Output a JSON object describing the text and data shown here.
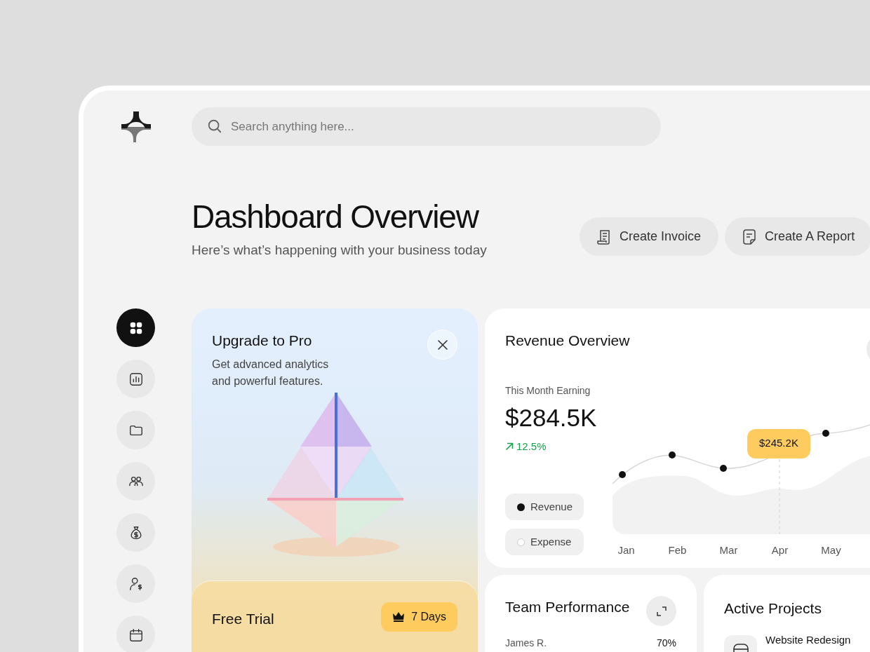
{
  "search": {
    "placeholder": "Search anything here..."
  },
  "header": {
    "title": "Dashboard Overview",
    "subtitle": "Here’s what’s happening with your business today"
  },
  "actions": [
    {
      "kind": "invoice",
      "label": "Create Invoice"
    },
    {
      "kind": "report",
      "label": "Create A Report"
    }
  ],
  "sidebar": {
    "items": [
      {
        "kind": "dashboard",
        "selected": true
      },
      {
        "kind": "analytics",
        "selected": false
      },
      {
        "kind": "files",
        "selected": false
      },
      {
        "kind": "team",
        "selected": false
      },
      {
        "kind": "finance",
        "selected": false
      },
      {
        "kind": "clients",
        "selected": false
      },
      {
        "kind": "calendar",
        "selected": false
      }
    ]
  },
  "promo": {
    "title": "Upgrade to Pro",
    "description": "Get advanced analytics and powerful features.",
    "trial": {
      "title": "Free Trial",
      "badge": "7 Days"
    }
  },
  "revenue": {
    "title": "Revenue Overview",
    "earning_label": "This Month Earning",
    "earning_value": "$284.5K",
    "change": "12.5%",
    "tooltip": "$245.2K",
    "legend": [
      {
        "label": "Revenue",
        "selected": true
      },
      {
        "label": "Expense",
        "selected": false
      }
    ],
    "months": [
      "Jan",
      "Feb",
      "Mar",
      "Apr",
      "May"
    ]
  },
  "team": {
    "title": "Team Performance",
    "members": [
      {
        "name": "James R.",
        "value": "70%"
      }
    ]
  },
  "projects": {
    "title": "Active Projects",
    "items": [
      {
        "name": "Website Redesign"
      }
    ]
  }
}
